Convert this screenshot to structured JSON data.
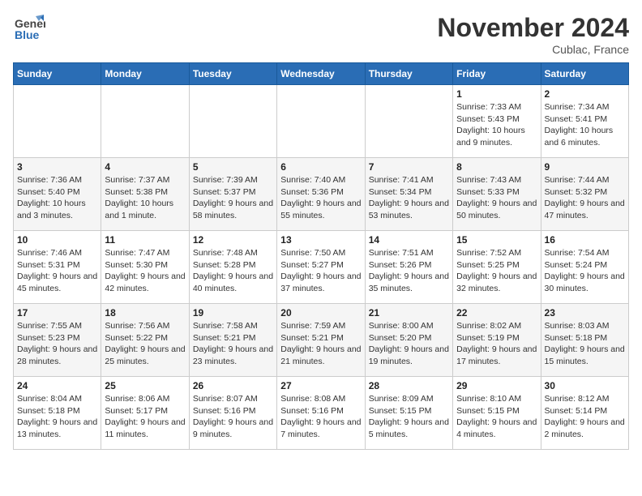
{
  "header": {
    "logo_general": "General",
    "logo_blue": "Blue",
    "month_title": "November 2024",
    "location": "Cublac, France"
  },
  "weekdays": [
    "Sunday",
    "Monday",
    "Tuesday",
    "Wednesday",
    "Thursday",
    "Friday",
    "Saturday"
  ],
  "weeks": [
    [
      {
        "day": "",
        "info": ""
      },
      {
        "day": "",
        "info": ""
      },
      {
        "day": "",
        "info": ""
      },
      {
        "day": "",
        "info": ""
      },
      {
        "day": "",
        "info": ""
      },
      {
        "day": "1",
        "info": "Sunrise: 7:33 AM\nSunset: 5:43 PM\nDaylight: 10 hours and 9 minutes."
      },
      {
        "day": "2",
        "info": "Sunrise: 7:34 AM\nSunset: 5:41 PM\nDaylight: 10 hours and 6 minutes."
      }
    ],
    [
      {
        "day": "3",
        "info": "Sunrise: 7:36 AM\nSunset: 5:40 PM\nDaylight: 10 hours and 3 minutes."
      },
      {
        "day": "4",
        "info": "Sunrise: 7:37 AM\nSunset: 5:38 PM\nDaylight: 10 hours and 1 minute."
      },
      {
        "day": "5",
        "info": "Sunrise: 7:39 AM\nSunset: 5:37 PM\nDaylight: 9 hours and 58 minutes."
      },
      {
        "day": "6",
        "info": "Sunrise: 7:40 AM\nSunset: 5:36 PM\nDaylight: 9 hours and 55 minutes."
      },
      {
        "day": "7",
        "info": "Sunrise: 7:41 AM\nSunset: 5:34 PM\nDaylight: 9 hours and 53 minutes."
      },
      {
        "day": "8",
        "info": "Sunrise: 7:43 AM\nSunset: 5:33 PM\nDaylight: 9 hours and 50 minutes."
      },
      {
        "day": "9",
        "info": "Sunrise: 7:44 AM\nSunset: 5:32 PM\nDaylight: 9 hours and 47 minutes."
      }
    ],
    [
      {
        "day": "10",
        "info": "Sunrise: 7:46 AM\nSunset: 5:31 PM\nDaylight: 9 hours and 45 minutes."
      },
      {
        "day": "11",
        "info": "Sunrise: 7:47 AM\nSunset: 5:30 PM\nDaylight: 9 hours and 42 minutes."
      },
      {
        "day": "12",
        "info": "Sunrise: 7:48 AM\nSunset: 5:28 PM\nDaylight: 9 hours and 40 minutes."
      },
      {
        "day": "13",
        "info": "Sunrise: 7:50 AM\nSunset: 5:27 PM\nDaylight: 9 hours and 37 minutes."
      },
      {
        "day": "14",
        "info": "Sunrise: 7:51 AM\nSunset: 5:26 PM\nDaylight: 9 hours and 35 minutes."
      },
      {
        "day": "15",
        "info": "Sunrise: 7:52 AM\nSunset: 5:25 PM\nDaylight: 9 hours and 32 minutes."
      },
      {
        "day": "16",
        "info": "Sunrise: 7:54 AM\nSunset: 5:24 PM\nDaylight: 9 hours and 30 minutes."
      }
    ],
    [
      {
        "day": "17",
        "info": "Sunrise: 7:55 AM\nSunset: 5:23 PM\nDaylight: 9 hours and 28 minutes."
      },
      {
        "day": "18",
        "info": "Sunrise: 7:56 AM\nSunset: 5:22 PM\nDaylight: 9 hours and 25 minutes."
      },
      {
        "day": "19",
        "info": "Sunrise: 7:58 AM\nSunset: 5:21 PM\nDaylight: 9 hours and 23 minutes."
      },
      {
        "day": "20",
        "info": "Sunrise: 7:59 AM\nSunset: 5:21 PM\nDaylight: 9 hours and 21 minutes."
      },
      {
        "day": "21",
        "info": "Sunrise: 8:00 AM\nSunset: 5:20 PM\nDaylight: 9 hours and 19 minutes."
      },
      {
        "day": "22",
        "info": "Sunrise: 8:02 AM\nSunset: 5:19 PM\nDaylight: 9 hours and 17 minutes."
      },
      {
        "day": "23",
        "info": "Sunrise: 8:03 AM\nSunset: 5:18 PM\nDaylight: 9 hours and 15 minutes."
      }
    ],
    [
      {
        "day": "24",
        "info": "Sunrise: 8:04 AM\nSunset: 5:18 PM\nDaylight: 9 hours and 13 minutes."
      },
      {
        "day": "25",
        "info": "Sunrise: 8:06 AM\nSunset: 5:17 PM\nDaylight: 9 hours and 11 minutes."
      },
      {
        "day": "26",
        "info": "Sunrise: 8:07 AM\nSunset: 5:16 PM\nDaylight: 9 hours and 9 minutes."
      },
      {
        "day": "27",
        "info": "Sunrise: 8:08 AM\nSunset: 5:16 PM\nDaylight: 9 hours and 7 minutes."
      },
      {
        "day": "28",
        "info": "Sunrise: 8:09 AM\nSunset: 5:15 PM\nDaylight: 9 hours and 5 minutes."
      },
      {
        "day": "29",
        "info": "Sunrise: 8:10 AM\nSunset: 5:15 PM\nDaylight: 9 hours and 4 minutes."
      },
      {
        "day": "30",
        "info": "Sunrise: 8:12 AM\nSunset: 5:14 PM\nDaylight: 9 hours and 2 minutes."
      }
    ]
  ]
}
